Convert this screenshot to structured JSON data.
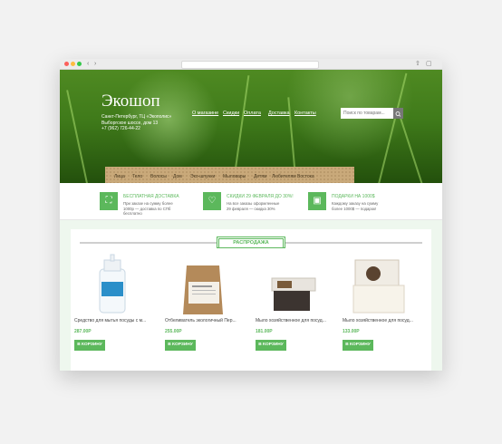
{
  "header": {
    "logo": "Экошоп",
    "address": "Санкт-Петербург, ТЦ «Экополис» Выборгское шоссе, дом 13",
    "phone": "+7 (962) 726-44-22",
    "nav": [
      "О магазине",
      "Скидки",
      "Оплата",
      "Доставка",
      "Контакты"
    ],
    "search_placeholder": "Поиск по товарам..."
  },
  "categories": [
    "Лица",
    "Тело",
    "Волосы",
    "Дом",
    "Эко-шпунки",
    "Мыловары",
    "Детям",
    "Любителям Востока"
  ],
  "features": [
    {
      "icon": "delivery-icon",
      "title": "БЕСПЛАТНАЯ ДОСТАВКА",
      "desc": "При заказе на сумму более 1000р — доставка по СПб бесплатно"
    },
    {
      "icon": "heart-icon",
      "title": "СКИДКИ 29 ФЕВРАЛЯ ДО 30%!",
      "desc": "На все заказы оформленные 29 февраля — скидка 30%"
    },
    {
      "icon": "gift-icon",
      "title": "ПОДАРКИ НА 1000$",
      "desc": "Каждому заказу на сумму более 1000$ — подарок!"
    }
  ],
  "sale": {
    "title": "РАСПРОДАЖА",
    "add_label": "В КОРЗИНУ",
    "products": [
      {
        "name": "Средство для мытья посуды с м...",
        "price": "287.00Р"
      },
      {
        "name": "Отбеливатель экологичный Пер...",
        "price": "255.00Р"
      },
      {
        "name": "Мыло хозяйственное для посуд...",
        "price": "181.00Р"
      },
      {
        "name": "Мыло хозяйственное для посуд...",
        "price": "133.00Р"
      }
    ]
  },
  "colors": {
    "accent": "#5cb85c"
  }
}
